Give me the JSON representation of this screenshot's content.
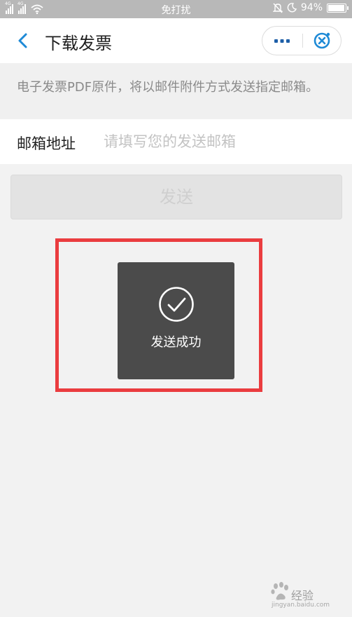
{
  "status_bar": {
    "sim1_label": "4G",
    "sim2_label": "4G",
    "dnd_text": "免打扰",
    "battery_percent": "94%",
    "battery_level": 0.94,
    "icons": [
      "signal-icon",
      "signal-icon",
      "wifi-icon",
      "bell-off-icon",
      "moon-icon",
      "battery-icon"
    ]
  },
  "nav": {
    "title": "下载发票",
    "back_icon": "chevron-left-icon",
    "more_icon": "more-dots-icon",
    "close_icon": "close-circle-icon"
  },
  "notice": {
    "text": "电子发票PDF原件，将以邮件附件方式发送指定邮箱。"
  },
  "email": {
    "label": "邮箱地址",
    "value": "",
    "placeholder": "请填写您的发送邮箱"
  },
  "send_button": {
    "label": "发送",
    "enabled": false
  },
  "toast": {
    "icon": "check-circle-icon",
    "message": "发送成功"
  },
  "watermark": {
    "text": "经验",
    "sub": "jingyan.baidu.com"
  },
  "colors": {
    "accent": "#1e8ad6",
    "highlight": "#ea3c3f",
    "toast_bg": "#4b4b4b",
    "page_bg": "#f2f2f2"
  }
}
